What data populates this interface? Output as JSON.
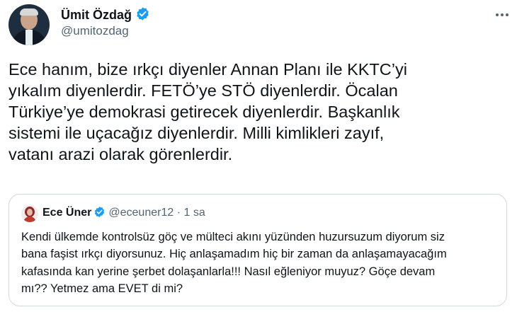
{
  "tweet": {
    "author": {
      "name": "Ümit Özdağ",
      "handle": "@umitozdag"
    },
    "text_lines": [
      "Ece hanım, bize ırkçı diyenler Annan Planı ile KKTC’yi",
      "yıkalım diyenlerdir. FETÖ’ye STÖ diyenlerdir. Öcalan",
      "Türkiye’ye demokrasi getirecek diyenlerdir. Başkanlık",
      "sistemi ile uçacağız diyenlerdir. Milli kimlikleri zayıf,",
      "vatanı arazi olarak görenlerdir."
    ]
  },
  "quoted_tweet": {
    "author": {
      "name": "Ece Üner",
      "handle": "@eceuner12",
      "separator": "·",
      "time": "1 sa"
    },
    "text_lines": [
      "Kendi ülkemde kontrolsüz göç ve mülteci akını yüzünden huzursuzum diyorum siz",
      "bana faşist ırkçı diyorsunuz. Hiç anlaşamadım hiç bir zaman da anlaşamayacağım",
      "kafasında kan yerine şerbet dolaşanlarla!!! Nasıl eğleniyor muyuz? Göçe devam",
      "mı?? Yetmez ama EVET di mi?"
    ]
  },
  "icons": {
    "verified": "verified-badge-icon",
    "more": "more-options-icon"
  },
  "colors": {
    "verified_blue": "#1d9bf0",
    "secondary_text": "#536471",
    "primary_text": "#0f1419",
    "border": "#cfd9de"
  }
}
